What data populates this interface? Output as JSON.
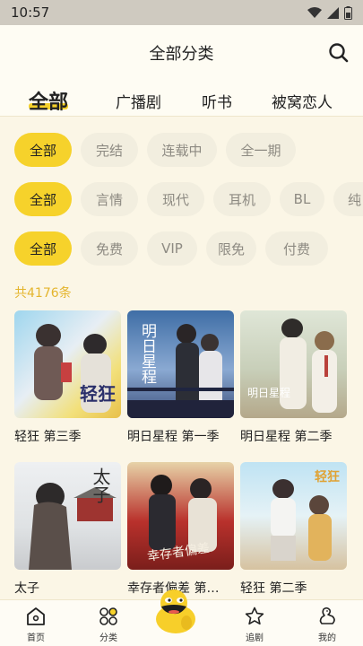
{
  "status": {
    "time": "10:57"
  },
  "header": {
    "title": "全部分类"
  },
  "tabs": [
    {
      "label": "全部"
    },
    {
      "label": "广播剧"
    },
    {
      "label": "听书"
    },
    {
      "label": "被窝恋人"
    }
  ],
  "filters": {
    "status_row": [
      "全部",
      "完结",
      "连载中",
      "全一期"
    ],
    "genre_row": [
      "全部",
      "言情",
      "现代",
      "耳机",
      "BL",
      "纯"
    ],
    "price_row": [
      "全部",
      "免费",
      "VIP",
      "限免",
      "付费"
    ]
  },
  "result_count": "共4176条",
  "items": [
    {
      "title": "轻狂 第三季",
      "cover_text": "轻狂"
    },
    {
      "title": "明日星程 第一季",
      "cover_text": "明日星程"
    },
    {
      "title": "明日星程 第二季",
      "cover_text": "明日星程"
    },
    {
      "title": "太子",
      "cover_text": "太子"
    },
    {
      "title": "幸存者偏差 第…",
      "cover_text": "幸存者偏差"
    },
    {
      "title": "轻狂 第二季",
      "cover_text": "轻狂"
    }
  ],
  "bottom_nav": [
    {
      "label": "首页",
      "icon": "home-icon"
    },
    {
      "label": "分类",
      "icon": "category-icon"
    },
    {
      "label": "追剧",
      "icon": "star-icon"
    },
    {
      "label": "我的",
      "icon": "profile-duck-icon"
    }
  ],
  "colors": {
    "accent": "#f6d22b",
    "background": "#fbf6e6",
    "count": "#e4b52e"
  }
}
